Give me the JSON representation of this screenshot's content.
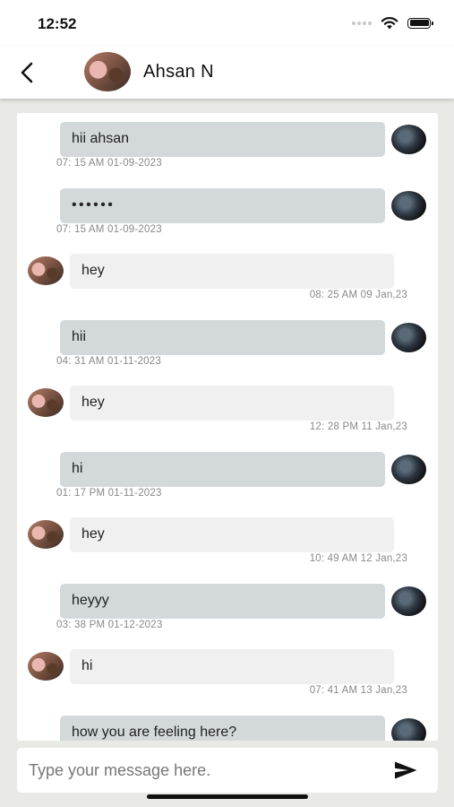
{
  "status_bar": {
    "time": "12:52"
  },
  "header": {
    "contact_name": "Ahsan N"
  },
  "messages": [
    {
      "direction": "sent",
      "text": "hii ahsan",
      "time": "07: 15 AM 01-09-2023"
    },
    {
      "direction": "sent",
      "text": "• • • • • •",
      "time": "07: 15 AM 01-09-2023"
    },
    {
      "direction": "received",
      "text": "hey",
      "time": "08: 25 AM 09 Jan,23"
    },
    {
      "direction": "sent",
      "text": "hii",
      "time": "04: 31 AM 01-11-2023"
    },
    {
      "direction": "received",
      "text": "hey",
      "time": "12: 28 PM 11 Jan,23"
    },
    {
      "direction": "sent",
      "text": "hi",
      "time": "01: 17 PM 01-11-2023"
    },
    {
      "direction": "received",
      "text": "hey",
      "time": "10: 49 AM 12 Jan,23"
    },
    {
      "direction": "sent",
      "text": "heyyy",
      "time": "03: 38 PM 01-12-2023"
    },
    {
      "direction": "received",
      "text": "hi",
      "time": "07: 41 AM 13 Jan,23"
    },
    {
      "direction": "sent",
      "text": "how you are feeling here?",
      "time": ""
    }
  ],
  "composer": {
    "placeholder": "Type your message here."
  },
  "icons": {
    "back": "chevron-left-icon",
    "send": "send-icon",
    "wifi": "wifi-icon",
    "battery": "battery-icon",
    "signal": "signal-icon"
  }
}
